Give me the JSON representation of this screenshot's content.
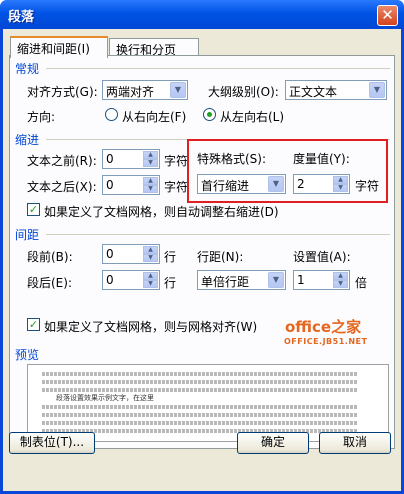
{
  "window": {
    "title": "段落",
    "close_glyph": "✕"
  },
  "tabs": [
    {
      "label": "缩进和间距(I)",
      "active": true
    },
    {
      "label": "换行和分页(P)",
      "active": false
    }
  ],
  "general": {
    "section": "常规",
    "align_label": "对齐方式(G):",
    "align_value": "两端对齐",
    "outline_label": "大纲级别(O):",
    "outline_value": "正文文本",
    "direction_label": "方向:",
    "rtl_label": "从右向左(F)",
    "ltr_label": "从左向右(L)"
  },
  "indent": {
    "section": "缩进",
    "before_label": "文本之前(R):",
    "before_value": "0",
    "before_unit": "字符",
    "after_label": "文本之后(X):",
    "after_value": "0",
    "after_unit": "字符",
    "special_label": "特殊格式(S):",
    "special_value": "首行缩进",
    "measure_label": "度量值(Y):",
    "measure_value": "2",
    "measure_unit": "字符",
    "grid_check_label": "如果定义了文档网格，则自动调整右缩进(D)",
    "grid_checked": true
  },
  "spacing": {
    "section": "间距",
    "before_label": "段前(B):",
    "before_value": "0",
    "before_unit": "行",
    "after_label": "段后(E):",
    "after_value": "0",
    "after_unit": "行",
    "line_label": "行距(N):",
    "line_value": "单倍行距",
    "setting_label": "设置值(A):",
    "setting_value": "1",
    "setting_unit": "倍",
    "grid_align_label": "如果定义了文档网格，则与网格对齐(W)",
    "grid_align_checked": true
  },
  "preview": {
    "section": "预览",
    "sample_text": "段落设置效果示例文字，在这里"
  },
  "watermark": {
    "brand": "office之家",
    "url": "OFFICE.JB51.NET"
  },
  "buttons": {
    "tabs": "制表位(T)...",
    "ok": "确定",
    "cancel": "取消"
  },
  "colors": {
    "section_blue": "#0046d5",
    "highlight_red": "#e02020",
    "title_blue": "#0053e4"
  }
}
